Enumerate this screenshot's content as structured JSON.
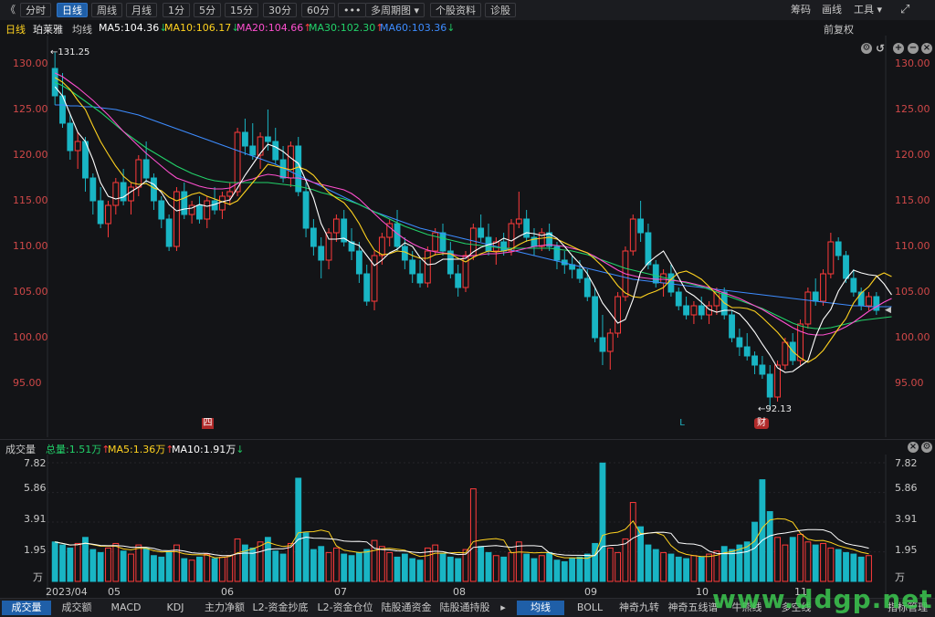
{
  "toolbar": {
    "back": "《",
    "periods": [
      "分时",
      "日线",
      "周线",
      "月线",
      "1分",
      "5分",
      "15分",
      "30分",
      "60分",
      "•••"
    ],
    "active_period": "日线",
    "multi_period": "多周期图",
    "stock_info": "个股资料",
    "diagnose": "诊股",
    "right_items": [
      "筹码",
      "画线",
      "工具"
    ],
    "fullscreen": "⤢"
  },
  "infobar": {
    "period": "日线",
    "stock_name": "珀莱雅",
    "ma_label": "均线",
    "ma5": "MA5:104.36",
    "ma10": "MA10:106.17",
    "ma20": "MA20:104.66",
    "ma30": "MA30:102.30",
    "ma60": "MA60:103.36",
    "adjust": "前复权"
  },
  "colors": {
    "ma5": "#ffffff",
    "ma10": "#ffd21f",
    "ma20": "#ff4fcf",
    "ma30": "#22d26a",
    "ma60": "#3d8cff",
    "up": "#ff3b3b",
    "down": "#19b5c4",
    "axis": "#d04848"
  },
  "price_axis": [
    "130.00",
    "125.00",
    "120.00",
    "115.00",
    "110.00",
    "105.00",
    "100.00",
    "95.00"
  ],
  "annotations": {
    "high": "131.25",
    "low": "92.13",
    "last_marker": "◀"
  },
  "markers": [
    "四",
    "L",
    "财"
  ],
  "volume": {
    "label": "成交量",
    "total": "总量:1.51万",
    "ma5": "MA5:1.36万",
    "ma10": "MA10:1.91万",
    "axis": [
      "7.82",
      "5.86",
      "3.91",
      "1.95",
      "万"
    ]
  },
  "x_axis": [
    "2023/04",
    "05",
    "06",
    "07",
    "08",
    "09",
    "10",
    "11"
  ],
  "chart_data": {
    "type": "candlestick",
    "ylim": [
      91,
      133
    ],
    "ohlc": [
      [
        129.5,
        131.25,
        125.5,
        126.5
      ],
      [
        126.5,
        129.0,
        123.0,
        123.5
      ],
      [
        123.5,
        124.5,
        119.5,
        120.5
      ],
      [
        120.5,
        122.5,
        118.5,
        121.5
      ],
      [
        121.5,
        122.0,
        116.0,
        117.5
      ],
      [
        117.5,
        118.0,
        113.5,
        115.0
      ],
      [
        115.0,
        116.5,
        112.0,
        112.5
      ],
      [
        112.5,
        115.0,
        111.0,
        114.5
      ],
      [
        114.5,
        117.5,
        113.5,
        117.0
      ],
      [
        117.0,
        118.5,
        114.5,
        115.0
      ],
      [
        115.0,
        117.0,
        113.5,
        116.5
      ],
      [
        116.5,
        120.0,
        115.5,
        119.5
      ],
      [
        119.5,
        121.5,
        117.0,
        117.5
      ],
      [
        117.5,
        118.0,
        114.0,
        115.0
      ],
      [
        115.0,
        115.5,
        112.0,
        113.0
      ],
      [
        113.0,
        113.5,
        109.5,
        110.0
      ],
      [
        110.0,
        116.5,
        109.5,
        116.0
      ],
      [
        116.0,
        117.0,
        113.0,
        113.5
      ],
      [
        113.5,
        115.0,
        112.5,
        114.5
      ],
      [
        114.5,
        115.5,
        112.5,
        113.0
      ],
      [
        113.0,
        115.5,
        112.0,
        115.0
      ],
      [
        115.0,
        116.5,
        113.5,
        114.0
      ],
      [
        114.0,
        116.0,
        113.0,
        115.5
      ],
      [
        115.5,
        117.0,
        114.5,
        116.0
      ],
      [
        116.0,
        123.0,
        115.5,
        122.5
      ],
      [
        122.5,
        124.0,
        120.0,
        121.0
      ],
      [
        121.0,
        123.5,
        119.5,
        120.0
      ],
      [
        120.0,
        122.5,
        118.5,
        122.0
      ],
      [
        122.0,
        125.0,
        120.5,
        121.5
      ],
      [
        121.5,
        123.0,
        119.0,
        119.5
      ],
      [
        119.5,
        121.0,
        117.0,
        117.5
      ],
      [
        117.5,
        121.5,
        116.5,
        121.0
      ],
      [
        121.0,
        122.0,
        115.5,
        116.0
      ],
      [
        116.0,
        117.0,
        111.0,
        112.0
      ],
      [
        112.0,
        113.0,
        109.0,
        110.0
      ],
      [
        110.0,
        111.0,
        106.5,
        108.5
      ],
      [
        108.5,
        112.0,
        107.5,
        111.5
      ],
      [
        111.5,
        113.5,
        110.5,
        113.0
      ],
      [
        113.0,
        114.0,
        110.0,
        110.5
      ],
      [
        110.5,
        112.0,
        108.5,
        109.5
      ],
      [
        109.5,
        110.5,
        106.0,
        107.0
      ],
      [
        107.0,
        108.0,
        103.5,
        104.0
      ],
      [
        104.0,
        109.5,
        103.0,
        109.0
      ],
      [
        109.0,
        111.5,
        108.0,
        111.0
      ],
      [
        111.0,
        113.0,
        110.0,
        112.5
      ],
      [
        112.5,
        114.0,
        109.5,
        110.0
      ],
      [
        110.0,
        111.0,
        107.5,
        108.5
      ],
      [
        108.5,
        109.5,
        106.0,
        107.0
      ],
      [
        107.0,
        108.5,
        105.5,
        106.0
      ],
      [
        106.0,
        110.0,
        105.5,
        109.5
      ],
      [
        109.5,
        112.0,
        109.0,
        111.5
      ],
      [
        111.5,
        112.5,
        109.0,
        109.5
      ],
      [
        109.5,
        110.5,
        106.5,
        107.0
      ],
      [
        107.0,
        108.0,
        104.5,
        105.5
      ],
      [
        105.5,
        109.5,
        105.0,
        109.0
      ],
      [
        109.0,
        112.5,
        108.5,
        112.0
      ],
      [
        112.0,
        113.5,
        110.5,
        111.0
      ],
      [
        111.0,
        112.5,
        109.0,
        109.5
      ],
      [
        109.5,
        111.0,
        108.0,
        110.5
      ],
      [
        110.5,
        111.5,
        109.0,
        109.5
      ],
      [
        109.5,
        113.0,
        109.0,
        112.5
      ],
      [
        112.5,
        116.0,
        112.0,
        113.0
      ],
      [
        113.0,
        114.0,
        110.5,
        111.0
      ],
      [
        111.0,
        112.0,
        109.0,
        110.0
      ],
      [
        110.0,
        112.0,
        109.5,
        111.5
      ],
      [
        111.5,
        112.5,
        109.5,
        110.0
      ],
      [
        110.0,
        110.5,
        107.5,
        108.5
      ],
      [
        108.5,
        109.5,
        107.0,
        108.0
      ],
      [
        108.0,
        109.0,
        106.5,
        107.5
      ],
      [
        107.5,
        108.5,
        106.0,
        106.5
      ],
      [
        106.5,
        107.5,
        104.0,
        104.5
      ],
      [
        104.5,
        105.5,
        99.5,
        100.0
      ],
      [
        100.0,
        102.5,
        97.0,
        98.5
      ],
      [
        98.5,
        101.0,
        96.5,
        100.5
      ],
      [
        100.5,
        105.0,
        100.0,
        104.5
      ],
      [
        104.5,
        110.0,
        104.0,
        109.5
      ],
      [
        109.5,
        113.5,
        109.0,
        113.0
      ],
      [
        113.0,
        115.0,
        110.5,
        111.5
      ],
      [
        111.5,
        112.5,
        107.5,
        108.0
      ],
      [
        108.0,
        108.5,
        105.5,
        106.0
      ],
      [
        106.0,
        107.5,
        104.5,
        107.0
      ],
      [
        107.0,
        108.0,
        104.5,
        105.0
      ],
      [
        105.0,
        105.5,
        103.0,
        103.5
      ],
      [
        103.5,
        104.5,
        102.0,
        102.5
      ],
      [
        102.5,
        104.0,
        101.5,
        103.5
      ],
      [
        103.5,
        104.5,
        102.0,
        102.5
      ],
      [
        102.5,
        104.0,
        101.5,
        103.5
      ],
      [
        103.5,
        105.5,
        102.5,
        105.0
      ],
      [
        105.0,
        105.5,
        102.0,
        102.5
      ],
      [
        102.5,
        103.0,
        99.5,
        100.0
      ],
      [
        100.0,
        101.0,
        98.0,
        99.0
      ],
      [
        99.0,
        100.5,
        97.5,
        98.0
      ],
      [
        98.0,
        98.5,
        96.0,
        97.0
      ],
      [
        97.0,
        98.0,
        95.5,
        96.0
      ],
      [
        96.0,
        97.0,
        92.13,
        93.5
      ],
      [
        93.5,
        97.5,
        93.0,
        97.0
      ],
      [
        97.0,
        100.0,
        96.5,
        99.5
      ],
      [
        99.5,
        100.5,
        97.0,
        97.5
      ],
      [
        97.5,
        102.0,
        97.0,
        101.5
      ],
      [
        101.5,
        105.5,
        101.0,
        105.0
      ],
      [
        105.0,
        106.5,
        103.5,
        104.0
      ],
      [
        104.0,
        107.5,
        103.5,
        107.0
      ],
      [
        107.0,
        111.5,
        106.5,
        110.5
      ],
      [
        110.5,
        111.0,
        108.5,
        109.0
      ],
      [
        109.0,
        109.5,
        106.0,
        106.5
      ],
      [
        106.5,
        107.5,
        104.5,
        105.0
      ],
      [
        105.0,
        105.5,
        103.0,
        103.5
      ],
      [
        103.5,
        105.0,
        103.0,
        104.5
      ],
      [
        104.5,
        105.0,
        102.5,
        103.0
      ]
    ],
    "volume": [
      2.6,
      2.4,
      2.2,
      2.5,
      2.9,
      2.1,
      1.9,
      2.2,
      2.5,
      2.0,
      1.8,
      2.4,
      2.2,
      1.7,
      1.6,
      1.9,
      2.4,
      1.5,
      1.4,
      1.6,
      1.8,
      1.5,
      1.6,
      1.7,
      2.8,
      2.4,
      2.2,
      2.6,
      2.9,
      2.0,
      1.8,
      2.5,
      6.8,
      3.2,
      2.1,
      2.3,
      1.9,
      2.2,
      1.8,
      1.7,
      1.9,
      2.1,
      2.7,
      2.3,
      1.9,
      1.6,
      1.8,
      1.5,
      1.4,
      2.2,
      2.4,
      1.8,
      1.6,
      1.5,
      2.1,
      6.1,
      2.3,
      1.9,
      1.7,
      1.6,
      1.9,
      2.6,
      1.8,
      1.5,
      1.7,
      1.9,
      1.4,
      1.3,
      1.5,
      1.6,
      1.8,
      2.5,
      7.8,
      2.2,
      1.9,
      2.8,
      5.2,
      3.6,
      2.4,
      2.1,
      1.9,
      1.8,
      1.6,
      1.5,
      1.7,
      1.6,
      1.8,
      2.0,
      2.3,
      2.1,
      2.4,
      2.6,
      3.9,
      6.7,
      4.6,
      2.9,
      2.4,
      2.9,
      3.1,
      2.6,
      2.4,
      2.5,
      2.2,
      2.1,
      1.9,
      1.8,
      1.6,
      1.7
    ],
    "ma5": [
      127.5,
      126.5,
      124.5,
      122.5,
      121.5,
      119.5,
      117.0,
      115.5,
      115.2,
      115.4,
      116.0,
      116.5,
      117.2,
      116.8,
      115.9,
      114.6,
      113.9,
      114.1,
      114.2,
      114.6,
      114.4,
      114.6,
      114.9,
      115.1,
      116.4,
      117.8,
      119.0,
      120.2,
      121.2,
      120.9,
      120.4,
      119.7,
      119.1,
      117.2,
      115.3,
      112.5,
      110.8,
      110.8,
      110.9,
      110.4,
      110.1,
      109.0,
      107.9,
      108.5,
      109.3,
      109.7,
      110.4,
      110.0,
      108.8,
      108.0,
      108.1,
      108.6,
      108.6,
      108.6,
      108.7,
      109.4,
      109.9,
      110.2,
      110.4,
      110.9,
      110.6,
      111.1,
      111.5,
      111.4,
      111.2,
      111.4,
      110.9,
      110.0,
      109.0,
      108.1,
      107.0,
      105.5,
      103.8,
      102.7,
      101.6,
      102.0,
      104.2,
      107.2,
      108.2,
      108.9,
      109.5,
      108.1,
      106.6,
      105.1,
      104.6,
      103.9,
      103.1,
      102.8,
      103.0,
      103.0,
      102.6,
      101.7,
      100.6,
      99.3,
      98.1,
      96.7,
      96.2,
      96.3,
      96.9,
      97.5,
      100.1,
      102.0,
      103.1,
      105.1,
      106.4,
      107.4,
      107.1,
      106.9,
      106.8,
      105.9,
      104.7
    ],
    "ma10": [
      128.5,
      128.0,
      127.2,
      126.0,
      125.0,
      123.2,
      121.5,
      120.1,
      118.8,
      117.7,
      117.0,
      116.8,
      116.9,
      116.4,
      116.1,
      115.4,
      115.0,
      115.3,
      115.7,
      115.9,
      115.5,
      115.2,
      114.9,
      114.6,
      115.0,
      116.0,
      117.0,
      118.0,
      119.0,
      118.8,
      118.6,
      118.4,
      118.7,
      118.4,
      117.8,
      116.8,
      115.9,
      115.3,
      114.8,
      113.8,
      112.5,
      110.9,
      109.6,
      109.1,
      109.2,
      109.5,
      109.4,
      109.0,
      108.7,
      108.7,
      109.1,
      109.2,
      109.2,
      108.7,
      108.3,
      108.8,
      109.2,
      109.5,
      109.4,
      109.5,
      109.7,
      110.2,
      110.6,
      110.8,
      110.9,
      111.0,
      110.8,
      110.4,
      110.0,
      109.6,
      109.3,
      108.6,
      107.8,
      106.8,
      105.7,
      104.9,
      104.5,
      104.4,
      104.8,
      105.1,
      105.5,
      106.4,
      107.1,
      107.3,
      106.9,
      106.4,
      105.6,
      104.7,
      103.8,
      103.3,
      103.3,
      103.2,
      102.9,
      102.2,
      101.4,
      100.6,
      99.6,
      98.5,
      97.8,
      97.3,
      97.8,
      98.6,
      99.8,
      101.0,
      102.1,
      103.8,
      104.9,
      105.6,
      106.7,
      107.1,
      106.7
    ],
    "ma20": [
      129.0,
      128.6,
      128.0,
      127.4,
      126.7,
      126.0,
      125.2,
      124.4,
      123.5,
      122.6,
      121.8,
      121.0,
      120.2,
      119.5,
      118.8,
      118.1,
      117.5,
      117.2,
      116.9,
      116.6,
      116.4,
      116.3,
      116.3,
      116.4,
      116.9,
      117.2,
      117.4,
      117.7,
      117.9,
      117.8,
      117.6,
      117.5,
      117.5,
      117.3,
      117.0,
      116.8,
      116.6,
      116.4,
      116.2,
      115.8,
      115.2,
      114.4,
      113.6,
      112.8,
      112.1,
      111.4,
      110.8,
      110.3,
      109.9,
      109.6,
      109.4,
      109.3,
      109.2,
      109.0,
      108.9,
      109.0,
      109.1,
      109.2,
      109.2,
      109.3,
      109.4,
      109.6,
      109.8,
      110.0,
      110.1,
      110.2,
      110.1,
      110.0,
      109.8,
      109.6,
      109.3,
      108.9,
      108.4,
      107.9,
      107.4,
      107.0,
      106.8,
      106.6,
      106.5,
      106.4,
      106.4,
      106.3,
      106.2,
      106.1,
      105.9,
      105.7,
      105.5,
      105.2,
      104.9,
      104.6,
      104.3,
      103.9,
      103.5,
      103.1,
      102.6,
      102.1,
      101.6,
      101.1,
      100.7,
      100.4,
      100.3,
      100.3,
      100.5,
      100.8,
      101.2,
      101.7,
      102.3,
      102.9,
      103.4,
      103.9,
      104.3
    ],
    "ma30": [
      128.0,
      127.6,
      127.1,
      126.5,
      125.9,
      125.3,
      124.7,
      124.0,
      123.3,
      122.6,
      122.0,
      121.4,
      120.8,
      120.3,
      119.8,
      119.3,
      118.8,
      118.4,
      118.0,
      117.7,
      117.4,
      117.2,
      117.1,
      117.0,
      117.0,
      117.0,
      117.0,
      117.0,
      117.0,
      116.9,
      116.8,
      116.7,
      116.6,
      116.4,
      116.2,
      115.9,
      115.7,
      115.4,
      115.2,
      114.9,
      114.6,
      114.2,
      113.8,
      113.4,
      113.0,
      112.6,
      112.2,
      111.9,
      111.6,
      111.3,
      111.1,
      110.9,
      110.7,
      110.5,
      110.3,
      110.2,
      110.1,
      110.0,
      109.9,
      109.8,
      109.8,
      109.8,
      109.8,
      109.8,
      109.8,
      109.8,
      109.7,
      109.6,
      109.5,
      109.3,
      109.1,
      108.8,
      108.5,
      108.2,
      107.9,
      107.6,
      107.4,
      107.2,
      107.0,
      106.8,
      106.6,
      106.4,
      106.2,
      106.0,
      105.8,
      105.6,
      105.3,
      105.0,
      104.7,
      104.4,
      104.1,
      103.8,
      103.5,
      103.2,
      102.8,
      102.4,
      102.0,
      101.6,
      101.3,
      101.1,
      101.0,
      101.0,
      101.1,
      101.3,
      101.5,
      101.7,
      101.9,
      102.0,
      102.1,
      102.2,
      102.3
    ],
    "ma60": [
      125.5,
      125.5,
      125.4,
      125.4,
      125.3,
      125.3,
      125.2,
      125.1,
      125.0,
      124.8,
      124.6,
      124.4,
      124.1,
      123.8,
      123.5,
      123.2,
      122.9,
      122.6,
      122.3,
      122.0,
      121.7,
      121.4,
      121.1,
      120.8,
      120.5,
      120.2,
      119.9,
      119.6,
      119.3,
      119.0,
      118.6,
      118.2,
      117.8,
      117.4,
      117.0,
      116.6,
      116.2,
      115.8,
      115.4,
      115.0,
      114.6,
      114.2,
      113.8,
      113.5,
      113.2,
      112.9,
      112.6,
      112.3,
      112.0,
      111.8,
      111.6,
      111.4,
      111.2,
      111.0,
      110.8,
      110.6,
      110.4,
      110.2,
      110.0,
      109.8,
      109.6,
      109.4,
      109.2,
      109.0,
      108.8,
      108.6,
      108.4,
      108.2,
      108.0,
      107.8,
      107.6,
      107.4,
      107.2,
      107.0,
      106.8,
      106.6,
      106.4,
      106.3,
      106.2,
      106.1,
      106.0,
      105.9,
      105.8,
      105.7,
      105.6,
      105.5,
      105.4,
      105.3,
      105.2,
      105.1,
      105.0,
      104.9,
      104.8,
      104.7,
      104.6,
      104.5,
      104.4,
      104.3,
      104.2,
      104.1,
      104.0,
      103.9,
      103.8,
      103.7,
      103.6,
      103.5,
      103.5,
      103.4,
      103.4,
      103.4,
      103.4
    ]
  },
  "bottom_tabs": [
    "成交量",
    "成交额",
    "MACD",
    "KDJ",
    "主力净额",
    "L2-资金抄底",
    "L2-资金仓位",
    "陆股通资金",
    "陆股通持股",
    "均线",
    "BOLL",
    "神奇九转",
    "神奇五线谱",
    "牛熊线",
    "多空线",
    "指标管理"
  ],
  "active_tab": "成交量",
  "active_tab2": "均线",
  "watermark": "www.ddgp.net"
}
